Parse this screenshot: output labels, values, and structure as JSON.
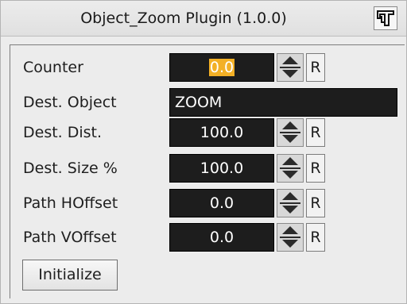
{
  "window": {
    "title": "Object_Zoom Plugin (1.0.0)",
    "plugin_icon": "plugin-logo-icon"
  },
  "fields": {
    "counter": {
      "label": "Counter",
      "value": "0.0",
      "reset_label": "R"
    },
    "dest_object": {
      "label": "Dest. Object",
      "value": "ZOOM"
    },
    "dest_dist": {
      "label": "Dest. Dist.",
      "value": "100.0",
      "reset_label": "R"
    },
    "dest_size": {
      "label": "Dest. Size %",
      "value": "100.0",
      "reset_label": "R"
    },
    "path_hoffset": {
      "label": "Path HOffset",
      "value": "0.0",
      "reset_label": "R"
    },
    "path_voffset": {
      "label": "Path VOffset",
      "value": "0.0",
      "reset_label": "R"
    }
  },
  "actions": {
    "initialize_label": "Initialize"
  },
  "colors": {
    "field_background": "#1d1d1d",
    "selection_highlight": "#f3b026",
    "panel_background": "#ececec"
  }
}
